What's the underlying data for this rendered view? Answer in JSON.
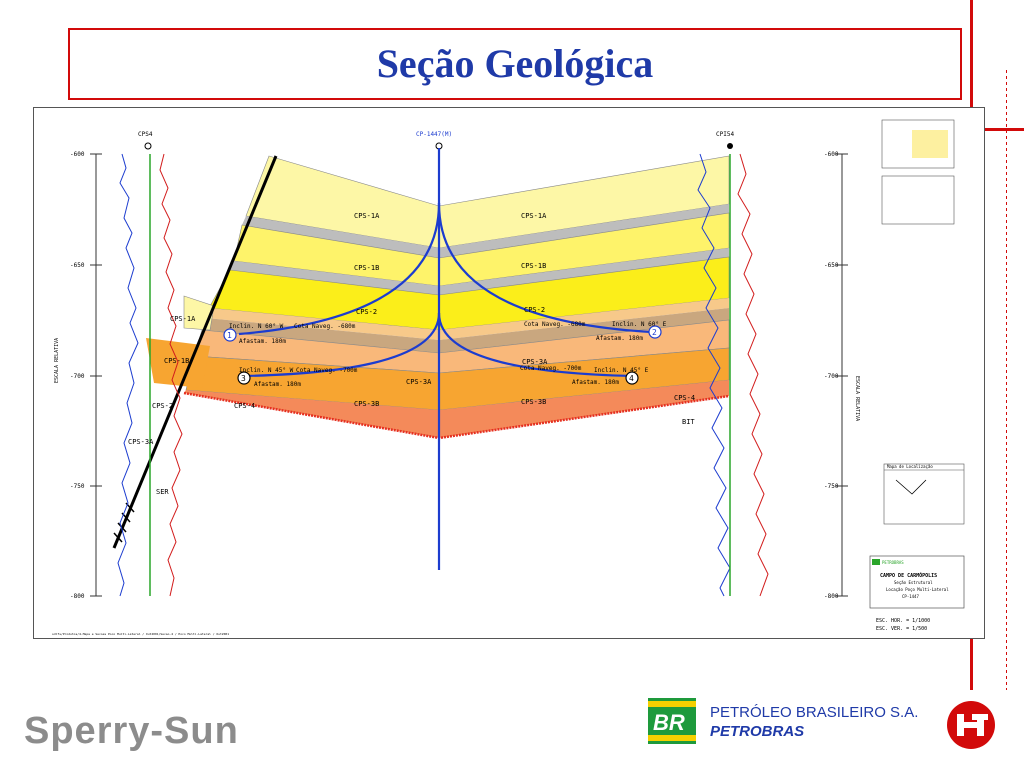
{
  "slide": {
    "title": "Seção Geológica"
  },
  "section": {
    "well_names": {
      "left": "CPS4",
      "center": "CP-1447(M)",
      "right": "CPI54"
    },
    "depth_ticks": [
      "-600",
      "-650",
      "-700",
      "-750",
      "-800"
    ],
    "scale_label_left": "ESCALA RELATIVA",
    "scale_label_right": "ESCALA RELATIVA",
    "zones": {
      "cps1a_l": "CPS-1A",
      "cps1a_r": "CPS-1A",
      "cps1b_l": "CPS-1B",
      "cps1b_r": "CPS-1B",
      "cps2_l": "CPS-2",
      "cps2_r": "CPS-2",
      "cps3a_c": "CPS-3A",
      "cps3a_r": "CPS-3A",
      "cps3b_l": "CPS-3B",
      "cps3b_r": "CPS-3B",
      "cps4_l": "CPS-4",
      "cps4_r": "CPS-4",
      "left_cps1a": "CPS-1A",
      "left_cps1b": "CPS-1B",
      "left_cps2": "CPS-2",
      "left_cps3a": "CPS-3A",
      "left_ser": "SER",
      "right_bit": "BIT"
    },
    "branches": {
      "b1_incl": "Inclin. N 60° W",
      "b1_cota": "Cota Naveg. -680m",
      "b1_afast": "Afastam. 180m",
      "b1_num": "1",
      "b2_incl": "Inclin. N 60° E",
      "b2_cota": "Cota Naveg. -680m",
      "b2_afast": "Afastam. 180m",
      "b2_num": "2",
      "b3_incl": "Inclin. N 45° W",
      "b3_cota": "Cota Naveg. -700m",
      "b3_afast": "Afastam. 180m",
      "b3_num": "3",
      "b4_incl": "Inclin. N 45° E",
      "b4_cota": "Cota Naveg. -700m",
      "b4_afast": "Afastam. 180m",
      "b4_num": "4"
    },
    "map_title": "Mapa de Localização",
    "title_block": {
      "company": "PETROBRAS",
      "field": "CAMPO DE CARMÓPOLIS",
      "subtitle": "Seção Estrutural",
      "line3": "Locação Poço Multi-Lateral",
      "well": "CP-1447"
    },
    "scale_hor": "ESC. HOR. = 1/1000",
    "scale_ver": "ESC. VER. = 1/500",
    "footer_path": "sdlfs/Produtos/4-Mapa e Secoes Poco Multi-Lateral / Out2001/Secao-4 / Poco Multi-Lateral / Out2001"
  },
  "footer": {
    "left_brand": "Sperry-Sun",
    "br_badge": "BR",
    "petro_line1": "PETRÓLEO BRASILEIRO S.A.",
    "petro_line2": "PETROBRAS"
  },
  "colors": {
    "accent_red": "#d20a0a",
    "title_blue": "#1f3aa8",
    "br_green": "#1e9a3c",
    "br_yellow": "#f5d000"
  }
}
